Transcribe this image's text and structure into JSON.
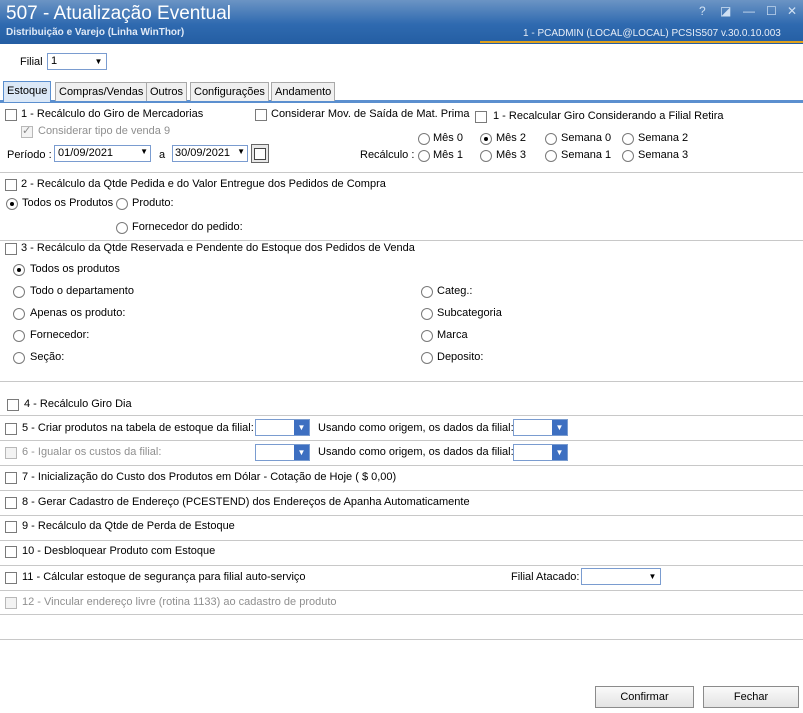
{
  "window": {
    "title": "507 - Atualização Eventual",
    "subtitle": "Distribuição e Varejo (Linha WinThor)",
    "session": "1 - PCADMIN (LOCAL@LOCAL)   PCSIS507  v.30.0.10.003",
    "help_glyph": "?",
    "restore_glyph": "◪",
    "minimize_glyph": "—",
    "maximize_glyph": "☐",
    "close_glyph": "✕"
  },
  "filial": {
    "label": "Filial",
    "value": "1"
  },
  "tabs": [
    "Estoque",
    "Compras/Vendas",
    "Outros",
    "Configurações",
    "Andamento"
  ],
  "s1": {
    "label": "1 - Recálculo do Giro de Mercadorias",
    "tipo_venda": "Considerar tipo de venda 9",
    "mov_saida": "Considerar Mov. de Saída de Mat. Prima",
    "filial_retira": "1 - Recalcular Giro Considerando a Filial Retira",
    "periodo_label": "Período :",
    "data_ini": "01/09/2021",
    "a_label": "a",
    "data_fim": "30/09/2021",
    "recalculo_label": "Recálculo :",
    "opts": [
      "Mês 0",
      "Mês 2",
      "Semana 0",
      "Semana 2",
      "Mês 1",
      "Mês 3",
      "Semana 1",
      "Semana 3"
    ]
  },
  "s2": {
    "label": "2 - Recálculo da Qtde Pedida e do Valor Entregue dos Pedidos de Compra",
    "todos": "Todos os Produtos",
    "produto": "Produto:",
    "fornecedor": "Fornecedor do pedido:"
  },
  "s3": {
    "label": "3 - Recálculo da Qtde Reservada e Pendente do Estoque dos Pedidos de Venda",
    "left": [
      "Todos os produtos",
      "Todo o departamento",
      "Apenas os produto:",
      "Fornecedor:",
      "Seção:"
    ],
    "right": [
      "Categ.:",
      "Subcategoria",
      "Marca",
      "Deposito:"
    ]
  },
  "items": {
    "i4": "4 - Recálculo Giro Dia",
    "i5": "5 - Criar produtos na tabela de estoque da filial:",
    "i5_origem": "Usando como origem, os dados da filial:",
    "i6": "6 - Igualar os custos da filial:",
    "i6_origem": "Usando como origem, os dados da filial:",
    "i7": "7 - Inicialização do Custo dos Produtos em Dólar - Cotação de Hoje ( $ 0,00)",
    "i8": "8 - Gerar Cadastro de Endereço (PCESTEND) dos Endereços de Apanha Automaticamente",
    "i9": "9 - Recálculo da Qtde de Perda de Estoque",
    "i10": "10 - Desbloquear Produto com Estoque",
    "i11": "11 - Cálcular estoque de segurança para filial auto-serviço",
    "i11_filial": "Filial Atacado:",
    "i12": "12 - Vincular endereço livre (rotina 1133) ao cadastro de produto"
  },
  "buttons": {
    "confirmar": "Confirmar",
    "fechar": "Fechar"
  },
  "icons": {
    "dropdown": "▼",
    "calendar": "calendar-icon",
    "check": "✓"
  },
  "colors": {
    "header": "#2f6ab0",
    "accent_line": "#e0a11b",
    "tab_active": "#dbe8f7",
    "dropdown_button": "#3d6fc1"
  }
}
